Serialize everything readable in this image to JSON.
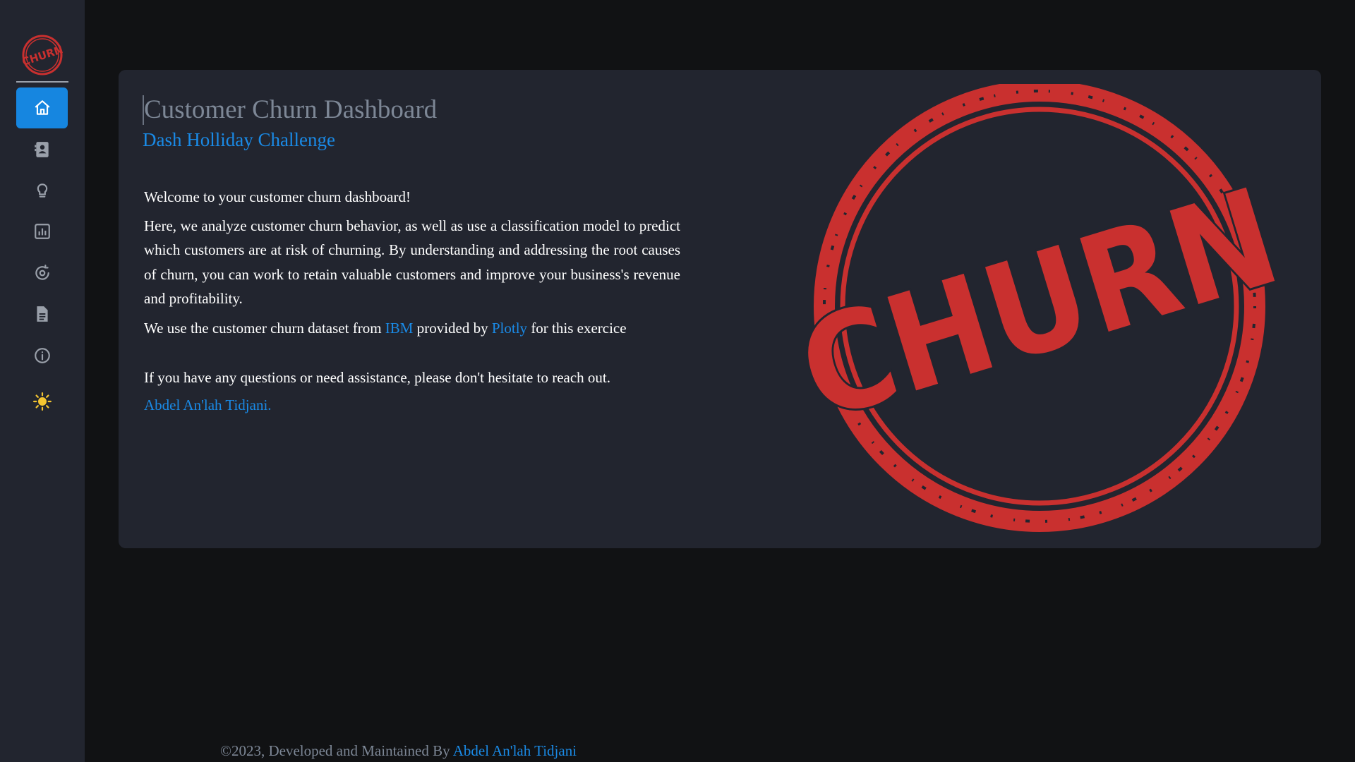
{
  "sidebar": {
    "logo_text": "CHURN",
    "items": [
      {
        "icon": "home-icon",
        "active": true
      },
      {
        "icon": "contact-card-icon",
        "active": false
      },
      {
        "icon": "lightbulb-icon",
        "active": false
      },
      {
        "icon": "bar-chart-icon",
        "active": false
      },
      {
        "icon": "target-refresh-icon",
        "active": false
      },
      {
        "icon": "document-icon",
        "active": false
      },
      {
        "icon": "info-icon",
        "active": false
      }
    ],
    "theme_toggle_icon": "sun-icon"
  },
  "main": {
    "title": "Customer Churn Dashboard",
    "subtitle": "Dash Holliday Challenge",
    "welcome": "Welcome to your customer churn dashboard!",
    "paragraph": "Here, we analyze customer churn behavior, as well as use a classification model to predict which customers are at risk of churning. By understanding and addressing the root causes of churn, you can work to retain valuable customers and improve your business's revenue and profitability.",
    "dataset_prefix": "We use the customer churn dataset from ",
    "dataset_link": "IBM",
    "dataset_middle": " provided by ",
    "provider_link": "Plotly",
    "dataset_suffix": " for this exercice",
    "contact": "If you have any questions or need assistance, please don't hesitate to reach out.",
    "author_link": "Abdel An'lah Tidjani.",
    "stamp_text": "CHURN"
  },
  "footer": {
    "prefix": "©2023, Developed and Maintained By ",
    "author_link": "Abdel An'lah Tidjani"
  },
  "colors": {
    "accent": "#1a8ae6",
    "stamp_red": "#c9302f",
    "sidebar_bg": "#22252f",
    "page_bg": "#111214"
  }
}
